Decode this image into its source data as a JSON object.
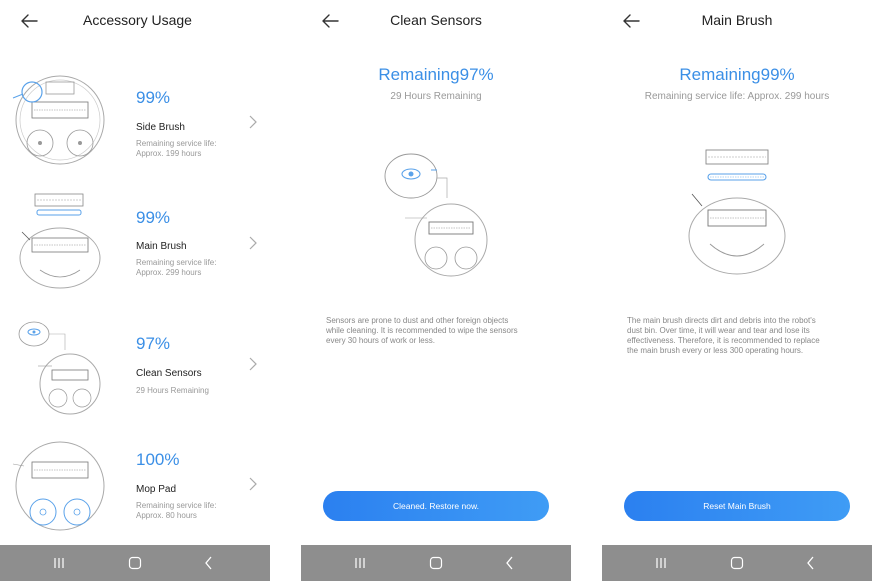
{
  "screens": {
    "accessory": {
      "title": "Accessory Usage",
      "items": [
        {
          "percent": "99%",
          "name": "Side Brush",
          "note_line1": "Remaining service life:",
          "note_line2": "Approx. 199 hours"
        },
        {
          "percent": "99%",
          "name": "Main Brush",
          "note_line1": "Remaining service life:",
          "note_line2": "Approx. 299 hours"
        },
        {
          "percent": "97%",
          "name": "Clean Sensors",
          "note_line1": "29 Hours Remaining",
          "note_line2": ""
        },
        {
          "percent": "100%",
          "name": "Mop Pad",
          "note_line1": "Remaining service life:",
          "note_line2": "Approx. 80 hours"
        }
      ]
    },
    "sensors": {
      "title": "Clean Sensors",
      "remaining": "Remaining97%",
      "sub": "29 Hours Remaining",
      "desc_line1": "Sensors are prone to dust and other foreign objects",
      "desc_line2": "while cleaning. It is recommended to wipe the sensors",
      "desc_line3": "every 30 hours of work or less.",
      "button": "Cleaned. Restore now."
    },
    "brush": {
      "title": "Main Brush",
      "remaining": "Remaining99%",
      "sub": "Remaining service life: Approx. 299 hours",
      "desc_line1": "The main brush directs dirt and debris into the robot's",
      "desc_line2": "dust bin. Over time, it will wear and tear and lose its",
      "desc_line3": "effectiveness. Therefore, it is recommended to replace",
      "desc_line4": "the main brush every or less 300 operating hours.",
      "button": "Reset Main Brush"
    }
  },
  "colors": {
    "accent": "#3b8fe6",
    "button_start": "#2b80f0",
    "button_end": "#3f9cf5",
    "navbar": "#8e8e8e"
  },
  "icons": {
    "back": "left-arrow-icon",
    "chevron": "chevron-right-icon",
    "nav_recent": "recent-apps-icon",
    "nav_home": "home-icon",
    "nav_back": "system-back-icon"
  }
}
